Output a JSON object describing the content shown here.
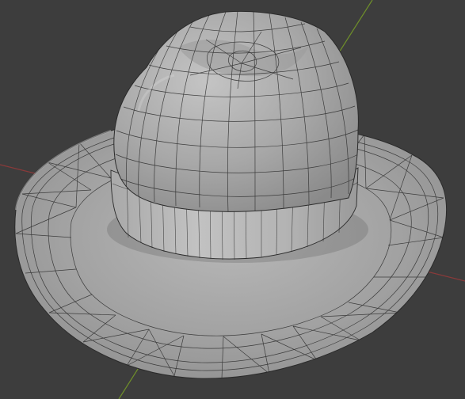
{
  "viewport": {
    "background": "#3d3d3d",
    "axes": {
      "x_axis_color": "#8a3a3a",
      "y_axis_color": "#6f8f2a"
    },
    "object": {
      "name": "Hat",
      "mode": "wireframe-overlay",
      "surface_color": "#a6a6a6",
      "wire_color": "#2b2b2b"
    }
  }
}
